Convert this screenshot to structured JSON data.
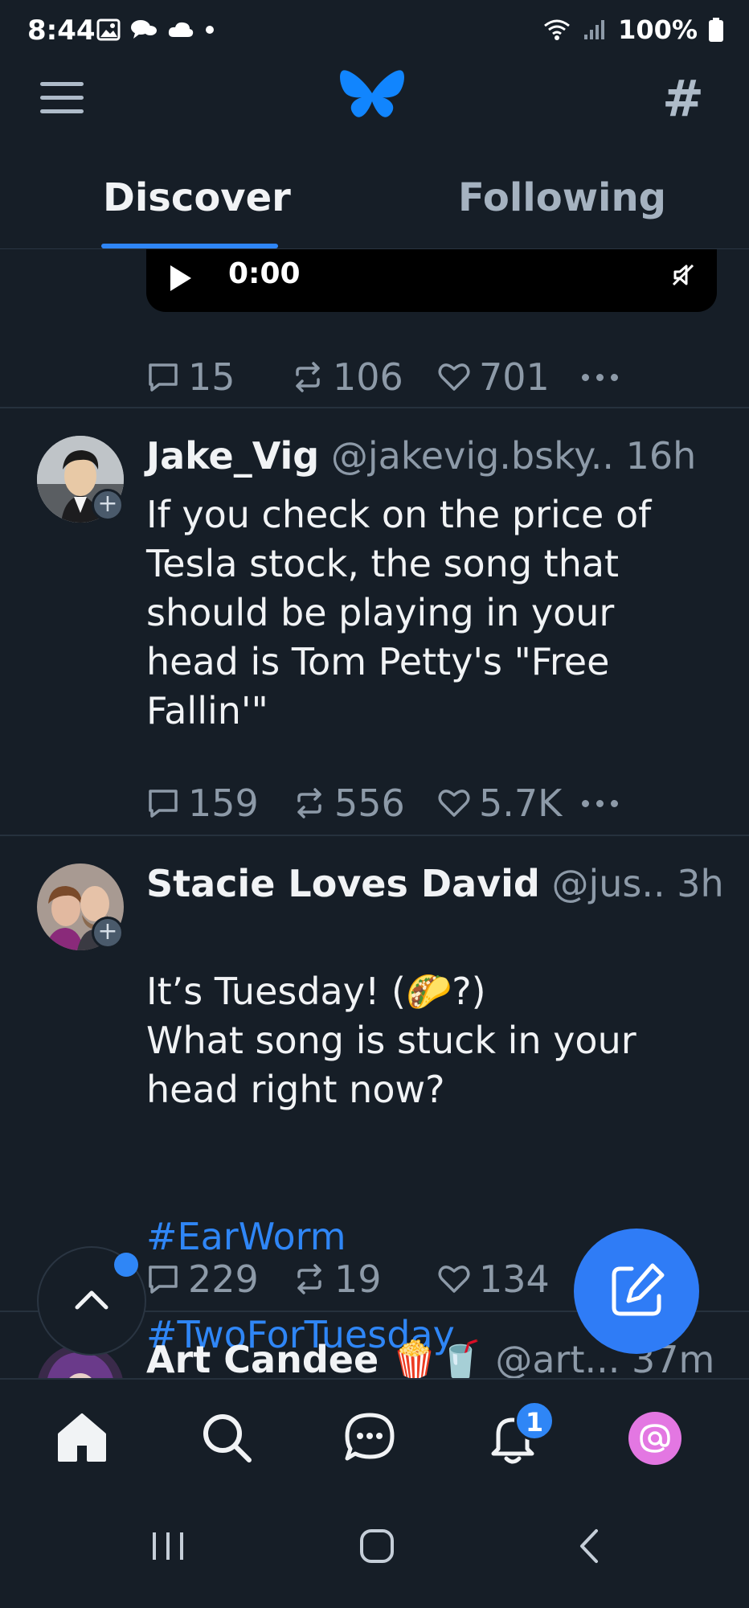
{
  "status_bar": {
    "time": "8:44",
    "battery": "100%"
  },
  "header": {
    "tabs": [
      {
        "label": "Discover",
        "active": true
      },
      {
        "label": "Following",
        "active": false
      }
    ]
  },
  "prev_post": {
    "video_time": "0:00",
    "replies": "15",
    "reposts": "106",
    "likes": "701"
  },
  "posts": [
    {
      "name": "Jake_Vig",
      "handle": "@jakevig.bsky..",
      "time": "16h",
      "text": "If you check on the price of Tesla stock, the song that should be playing in your head is Tom Petty's \"Free Fallin'\"",
      "replies": "159",
      "reposts": "556",
      "likes": "5.7K"
    },
    {
      "name": "Stacie Loves David",
      "handle": "@jus..",
      "time": "3h",
      "text": "It’s Tuesday!  (🌮?)\nWhat song is stuck in your head right now?",
      "hashtags": [
        "#EarWorm",
        "#TwoForTuesday"
      ],
      "replies": "229",
      "reposts": "19",
      "likes": "134"
    },
    {
      "name": "Art Candee 🍿🥤",
      "handle": "@art...",
      "time": "37m"
    }
  ],
  "bottom_nav": {
    "notification_count": "1"
  },
  "colors": {
    "background": "#161e27",
    "accent": "#2f86f6",
    "muted": "#8d9aa8"
  }
}
